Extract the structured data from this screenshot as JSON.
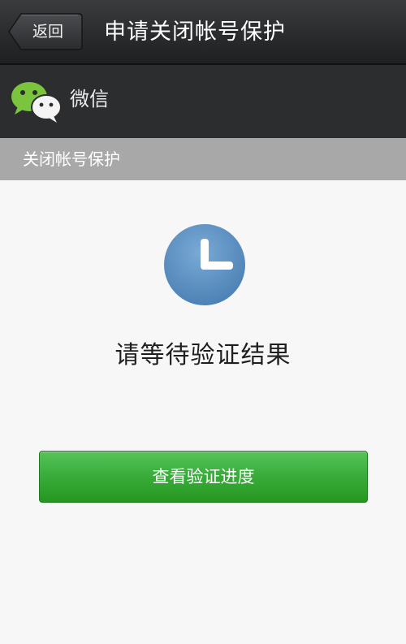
{
  "title_bar": {
    "back_label": "返回",
    "title": "申请关闭帐号保护"
  },
  "app_header": {
    "app_name": "微信",
    "logo_icon": "wechat-logo-icon"
  },
  "section": {
    "label": "关闭帐号保护"
  },
  "main": {
    "status_icon": "clock-icon",
    "status_message": "请等待验证结果",
    "primary_button_label": "查看验证进度"
  },
  "colors": {
    "title_bar_bg": "#2a2b2d",
    "section_bar_bg": "#a8a8a8",
    "button_green": "#3aae3d",
    "clock_blue": "#5b8fbf"
  }
}
